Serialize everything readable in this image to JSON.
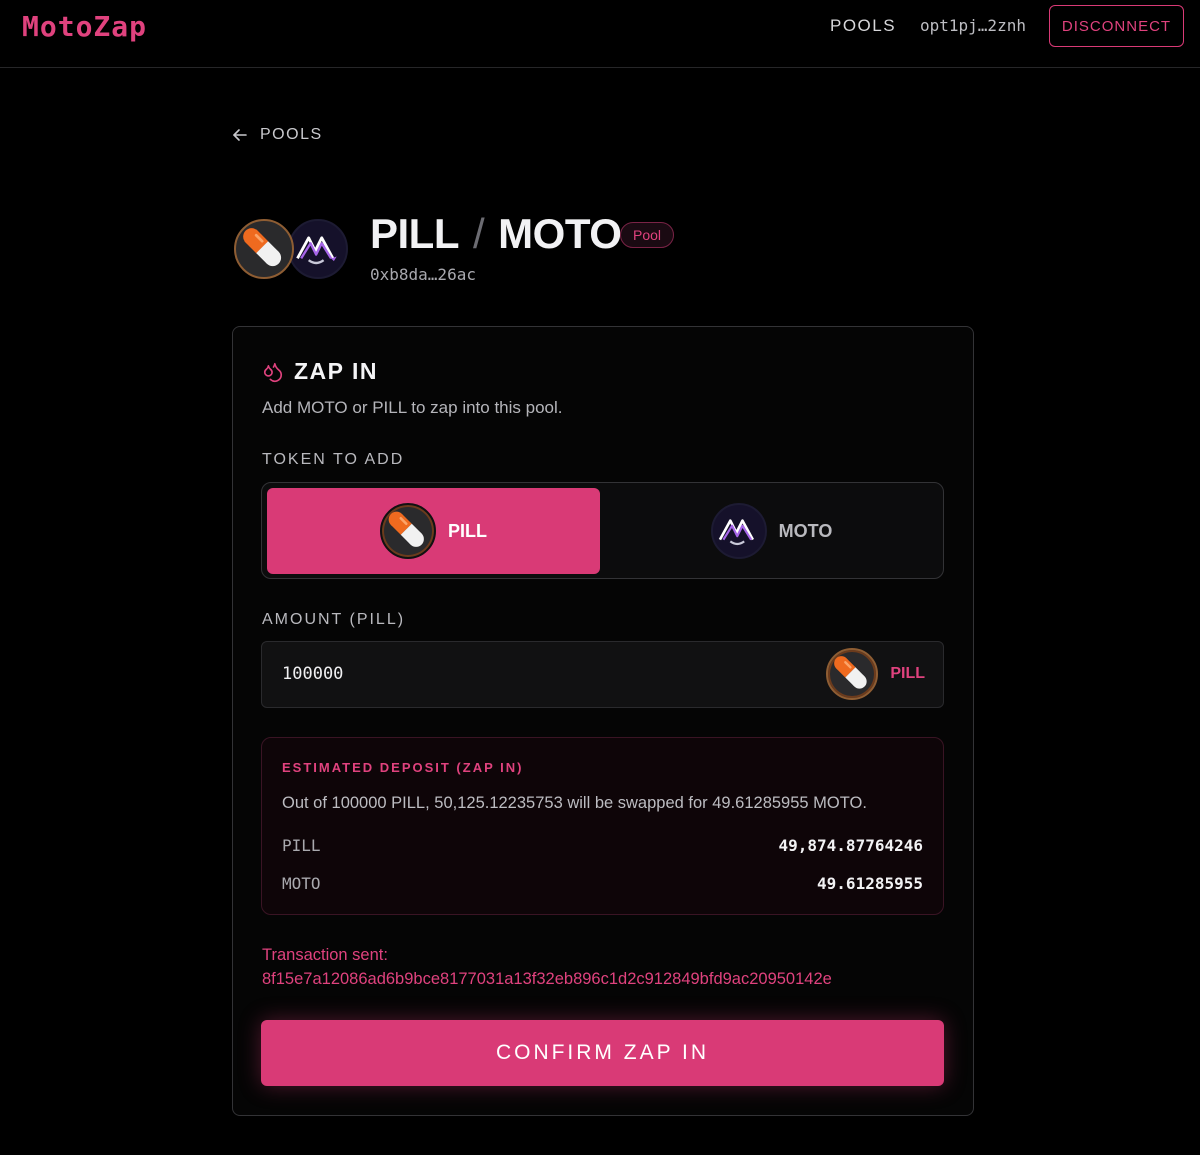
{
  "header": {
    "logo": "MotoZap",
    "nav_pools": "POOLS",
    "wallet": "opt1pj…2znh",
    "disconnect_label": "DISCONNECT"
  },
  "back_link": {
    "label": "POOLS",
    "icon": "arrow-left-icon"
  },
  "pair": {
    "token_a": "PILL",
    "separator": "/",
    "token_b": "MOTO",
    "badge": "Pool",
    "address": "0xb8da…26ac"
  },
  "zap": {
    "icon": "drops-icon",
    "title": "ZAP IN",
    "subtitle": "Add MOTO or PILL to zap into this pool.",
    "token_label": "TOKEN TO ADD",
    "options": [
      {
        "label": "PILL",
        "selected": true
      },
      {
        "label": "MOTO",
        "selected": false
      }
    ],
    "amount_label": "AMOUNT (PILL)",
    "amount_value": "100000",
    "amount_token": "PILL",
    "estimate": {
      "title": "ESTIMATED DEPOSIT (ZAP IN)",
      "description": "Out of 100000 PILL, 50,125.12235753 will be swapped for 49.61285955 MOTO.",
      "rows": [
        {
          "token": "PILL",
          "value": "49,874.87764246"
        },
        {
          "token": "MOTO",
          "value": "49.61285955"
        }
      ]
    },
    "tx_label": "Transaction sent:",
    "tx_hash": "8f15e7a12086ad6b9bce8177031a13f32eb896c1d2c912849bfd9ac20950142e",
    "confirm_label": "CONFIRM ZAP IN"
  },
  "colors": {
    "accent": "#d93a76",
    "accent_text": "#e0427e",
    "background": "#000000"
  }
}
